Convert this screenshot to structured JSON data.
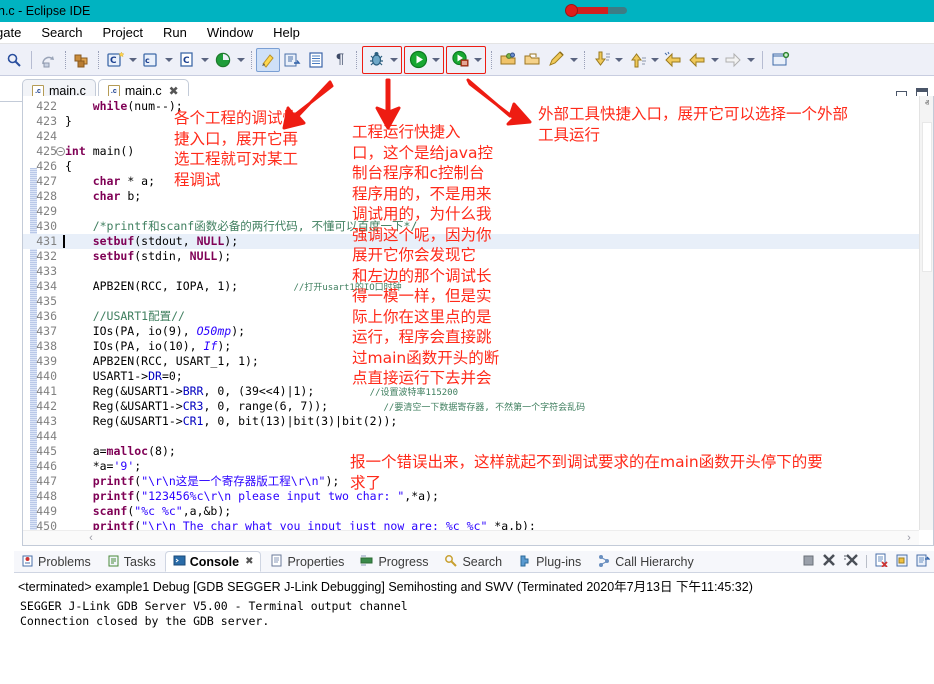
{
  "window": {
    "title": "n.c - Eclipse IDE",
    "thermometer_icon": "thermometer-widget"
  },
  "menubar": {
    "items": [
      {
        "label": "gate"
      },
      {
        "label": "Search"
      },
      {
        "label": "Project"
      },
      {
        "label": "Run"
      },
      {
        "label": "Window"
      },
      {
        "label": "Help"
      }
    ]
  },
  "toolbar": {
    "items": [
      {
        "name": "search-icon",
        "glyph": "search"
      },
      {
        "name": "save-all-icon",
        "glyph": "saveall"
      },
      {
        "name": "build-all-icon",
        "glyph": "buildall"
      },
      {
        "name": "new-c-project-icon",
        "glyph": "newcproj"
      },
      {
        "name": "new-cpp-project-icon",
        "glyph": "newcppproj"
      },
      {
        "name": "new-c-file-icon",
        "glyph": "newcfile"
      },
      {
        "name": "git-icon",
        "glyph": "git"
      },
      {
        "name": "highlight-icon",
        "glyph": "marker"
      },
      {
        "name": "export-icon",
        "glyph": "export"
      },
      {
        "name": "properties-icon",
        "glyph": "props"
      },
      {
        "name": "pilcrow-icon",
        "glyph": "pilcrow"
      },
      {
        "name": "debug-icon",
        "glyph": "bug"
      },
      {
        "name": "run-icon",
        "glyph": "run"
      },
      {
        "name": "external-tools-icon",
        "glyph": "exttools"
      },
      {
        "name": "open-type-icon",
        "glyph": "opentype"
      },
      {
        "name": "open-resource-icon",
        "glyph": "openres"
      },
      {
        "name": "pencil-icon",
        "glyph": "pencil"
      },
      {
        "name": "next-annotation-icon",
        "glyph": "nextanno"
      },
      {
        "name": "previous-annotation-icon",
        "glyph": "prevanno"
      },
      {
        "name": "back-to-icon",
        "glyph": "backto"
      },
      {
        "name": "back-icon",
        "glyph": "back"
      },
      {
        "name": "forward-icon",
        "glyph": "forward"
      },
      {
        "name": "new-window-icon",
        "glyph": "newwin"
      }
    ],
    "highlighted": [
      "debug-icon",
      "run-icon",
      "external-tools-icon"
    ],
    "highlight_color": "#ee1c12"
  },
  "editor": {
    "tabs": [
      {
        "label": "main.c",
        "active": false,
        "closable": false
      },
      {
        "label": "main.c",
        "active": true,
        "closable": true,
        "close_glyph": "✖"
      }
    ],
    "window_buttons": [
      {
        "name": "minimize-editor-button"
      },
      {
        "name": "maximize-editor-button"
      }
    ],
    "first_line": 422,
    "highlighted_line": 431,
    "lines": [
      {
        "n": 422,
        "segments": [
          {
            "t": "    ",
            "c": ""
          },
          {
            "t": "while",
            "c": "kw"
          },
          {
            "t": "(num--);",
            "c": ""
          }
        ]
      },
      {
        "n": 423,
        "segments": [
          {
            "t": "}",
            "c": ""
          }
        ]
      },
      {
        "n": 424,
        "segments": [
          {
            "t": "",
            "c": ""
          }
        ]
      },
      {
        "n": 425,
        "fold": true,
        "segments": [
          {
            "t": "int",
            "c": "kw"
          },
          {
            "t": " ",
            "c": ""
          },
          {
            "t": "main",
            "c": ""
          },
          {
            "t": "()",
            "c": ""
          }
        ]
      },
      {
        "n": 426,
        "segments": [
          {
            "t": "{",
            "c": ""
          }
        ]
      },
      {
        "n": 427,
        "segments": [
          {
            "t": "    ",
            "c": ""
          },
          {
            "t": "char",
            "c": "kw"
          },
          {
            "t": " * a;",
            "c": ""
          }
        ]
      },
      {
        "n": 428,
        "segments": [
          {
            "t": "    ",
            "c": ""
          },
          {
            "t": "char",
            "c": "kw"
          },
          {
            "t": " b;",
            "c": ""
          }
        ]
      },
      {
        "n": 429,
        "segments": [
          {
            "t": "",
            "c": ""
          }
        ]
      },
      {
        "n": 430,
        "segments": [
          {
            "t": "    /*printf和scanf函数必备的两行代码, 不懂可以百度一下*/",
            "c": "cmt"
          }
        ]
      },
      {
        "n": 431,
        "segments": [
          {
            "t": "    ",
            "c": ""
          },
          {
            "t": "setbuf",
            "c": "kw"
          },
          {
            "t": "(stdout, ",
            "c": ""
          },
          {
            "t": "NULL",
            "c": "kw"
          },
          {
            "t": ");",
            "c": ""
          }
        ]
      },
      {
        "n": 432,
        "segments": [
          {
            "t": "    ",
            "c": ""
          },
          {
            "t": "setbuf",
            "c": "kw"
          },
          {
            "t": "(stdin, ",
            "c": ""
          },
          {
            "t": "NULL",
            "c": "kw"
          },
          {
            "t": ");",
            "c": ""
          }
        ]
      },
      {
        "n": 433,
        "segments": [
          {
            "t": "",
            "c": ""
          }
        ]
      },
      {
        "n": 434,
        "segments": [
          {
            "t": "    APB2EN(RCC, IOPA, 1);",
            "c": ""
          }
        ],
        "comment": "//打开usart1的IO口时钟"
      },
      {
        "n": 435,
        "segments": [
          {
            "t": "",
            "c": ""
          }
        ]
      },
      {
        "n": 436,
        "segments": [
          {
            "t": "    //USART1配置//",
            "c": "cmt"
          }
        ]
      },
      {
        "n": 437,
        "segments": [
          {
            "t": "    IOs(PA, io(9), ",
            "c": ""
          },
          {
            "t": "O50mp",
            "c": "ital"
          },
          {
            "t": ");",
            "c": ""
          }
        ]
      },
      {
        "n": 438,
        "segments": [
          {
            "t": "    IOs(PA, io(10), ",
            "c": ""
          },
          {
            "t": "If",
            "c": "ital"
          },
          {
            "t": ");",
            "c": ""
          }
        ]
      },
      {
        "n": 439,
        "segments": [
          {
            "t": "    APB2EN(RCC, USART_1, 1);",
            "c": ""
          }
        ]
      },
      {
        "n": 440,
        "segments": [
          {
            "t": "    USART1->",
            "c": ""
          },
          {
            "t": "DR",
            "c": "mem"
          },
          {
            "t": "=0;",
            "c": ""
          }
        ]
      },
      {
        "n": 441,
        "segments": [
          {
            "t": "    Reg(&USART1->",
            "c": ""
          },
          {
            "t": "BRR",
            "c": "mem"
          },
          {
            "t": ", 0, (39<<4)|1);",
            "c": ""
          }
        ],
        "comment": "//设置波特率115200"
      },
      {
        "n": 442,
        "segments": [
          {
            "t": "    Reg(&USART1->",
            "c": ""
          },
          {
            "t": "CR3",
            "c": "mem"
          },
          {
            "t": ", 0, range(6, 7));",
            "c": ""
          }
        ],
        "comment": "//要清空一下数据寄存器, 不然第一个字符会乱码"
      },
      {
        "n": 443,
        "segments": [
          {
            "t": "    Reg(&USART1->",
            "c": ""
          },
          {
            "t": "CR1",
            "c": "mem"
          },
          {
            "t": ", 0, bit(13)|bit(3)|bit(2));",
            "c": ""
          }
        ]
      },
      {
        "n": 444,
        "segments": [
          {
            "t": "",
            "c": ""
          }
        ]
      },
      {
        "n": 445,
        "segments": [
          {
            "t": "    a=",
            "c": ""
          },
          {
            "t": "malloc",
            "c": "kw"
          },
          {
            "t": "(8);",
            "c": ""
          }
        ]
      },
      {
        "n": 446,
        "segments": [
          {
            "t": "    *a=",
            "c": ""
          },
          {
            "t": "'9'",
            "c": "str"
          },
          {
            "t": ";",
            "c": ""
          }
        ]
      },
      {
        "n": 447,
        "segments": [
          {
            "t": "    ",
            "c": ""
          },
          {
            "t": "printf",
            "c": "kw"
          },
          {
            "t": "(",
            "c": ""
          },
          {
            "t": "\"\\r\\n这是一个寄存器版工程\\r\\n\"",
            "c": "str"
          },
          {
            "t": ");",
            "c": ""
          }
        ]
      },
      {
        "n": 448,
        "segments": [
          {
            "t": "    ",
            "c": ""
          },
          {
            "t": "printf",
            "c": "kw"
          },
          {
            "t": "(",
            "c": ""
          },
          {
            "t": "\"123456%c\\r\\n please input two char: \"",
            "c": "str"
          },
          {
            "t": ",*a);",
            "c": ""
          }
        ]
      },
      {
        "n": 449,
        "segments": [
          {
            "t": "    ",
            "c": ""
          },
          {
            "t": "scanf",
            "c": "kw"
          },
          {
            "t": "(",
            "c": ""
          },
          {
            "t": "\"%c %c\"",
            "c": "str"
          },
          {
            "t": ",a,&b);",
            "c": ""
          }
        ]
      },
      {
        "n": 450,
        "segments": [
          {
            "t": "    ",
            "c": ""
          },
          {
            "t": "printf",
            "c": "kw"
          },
          {
            "t": "(",
            "c": ""
          },
          {
            "t": "\"\\r\\n The char what you input just now are: %c %c\"",
            "c": "str"
          },
          {
            "t": " *a,b);",
            "c": ""
          }
        ]
      }
    ],
    "scrollbar": {
      "up_glyph": "ⱏ",
      "down_glyph": "ⱟ",
      "left_glyph": "‹",
      "right_glyph": "›"
    }
  },
  "annotations": [
    {
      "name": "debug-annotation",
      "text": "各个工程的调试快\n捷入口，展开它再\n选工程就可对某工\n程调试"
    },
    {
      "name": "run-annotation",
      "text": "工程运行快捷入\n口，这个是给java控\n制台程序和c控制台\n程序用的，不是用来\n调试用的，为什么我\n强调这个呢，因为你\n展开它你会发现它\n和左边的那个调试长\n得一模一样，但是实\n际上你在这里点的是\n运行，程序会直接跳\n过main函数开头的断\n点直接运行下去并会"
    },
    {
      "name": "run-annotation-tail",
      "text": "报一个错误出来，这样就起不到调试要求的在main函数开头停下的要\n求了"
    },
    {
      "name": "external-tools-annotation",
      "text": "外部工具快捷入口，展开它可以选择一个外部\n工具运行"
    }
  ],
  "bottom_panel": {
    "tabs": [
      {
        "label": "Problems",
        "icon": "problems-icon",
        "active": false
      },
      {
        "label": "Tasks",
        "icon": "tasks-icon",
        "active": false
      },
      {
        "label": "Console",
        "icon": "console-icon",
        "active": true,
        "close_glyph": "✖"
      },
      {
        "label": "Properties",
        "icon": "properties-icon",
        "active": false
      },
      {
        "label": "Progress",
        "icon": "progress-icon",
        "active": false
      },
      {
        "label": "Search",
        "icon": "search-icon",
        "active": false
      },
      {
        "label": "Plug-ins",
        "icon": "plugins-icon",
        "active": false
      },
      {
        "label": "Call Hierarchy",
        "icon": "call-hierarchy-icon",
        "active": false
      }
    ],
    "toolbar_icons": [
      {
        "name": "terminate-icon"
      },
      {
        "name": "remove-launch-icon"
      },
      {
        "name": "remove-all-launches-icon"
      },
      {
        "name": "clear-console-icon"
      },
      {
        "name": "scroll-lock-icon"
      },
      {
        "name": "pin-console-icon"
      }
    ],
    "status_line": "<terminated> example1 Debug [GDB SEGGER J-Link Debugging] Semihosting and SWV (Terminated 2020年7月13日 下午11:45:32)",
    "console_output": "SEGGER J-Link GDB Server V5.00 - Terminal output channel\nConnection closed by the GDB server."
  }
}
